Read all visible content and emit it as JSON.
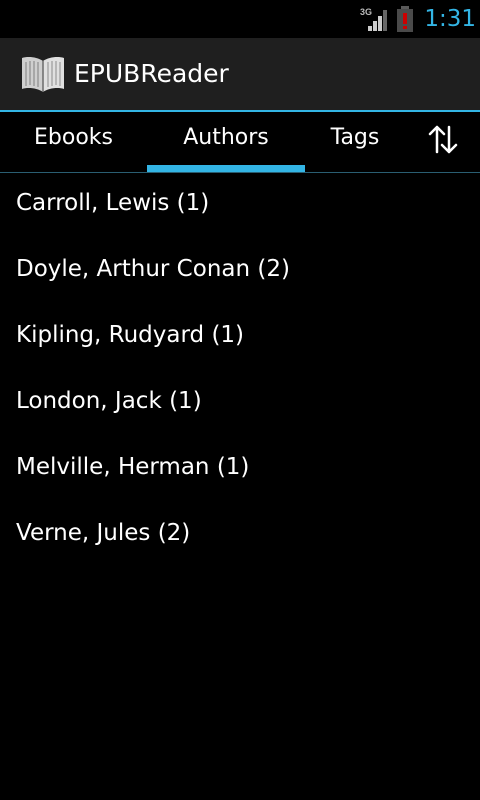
{
  "status_bar": {
    "network_label": "3G",
    "clock": "1:31",
    "icons": [
      "signal-3g-icon",
      "battery-low-icon"
    ],
    "colors": {
      "clock": "#33b5e5",
      "battery_alert": "#cc0000"
    }
  },
  "action_bar": {
    "app_icon": "open-book-icon",
    "title": "EPUBReader",
    "background": "#1f1f1f"
  },
  "tabs": {
    "items": [
      {
        "label": "Ebooks",
        "selected": false
      },
      {
        "label": "Authors",
        "selected": true
      },
      {
        "label": "Tags",
        "selected": false
      }
    ],
    "sort_icon": "sort-icon",
    "accent_color": "#33b5e5"
  },
  "authors": [
    {
      "label": "Carroll, Lewis (1)"
    },
    {
      "label": "Doyle, Arthur Conan (2)"
    },
    {
      "label": "Kipling, Rudyard (1)"
    },
    {
      "label": "London, Jack (1)"
    },
    {
      "label": "Melville, Herman (1)"
    },
    {
      "label": "Verne, Jules (2)"
    }
  ]
}
